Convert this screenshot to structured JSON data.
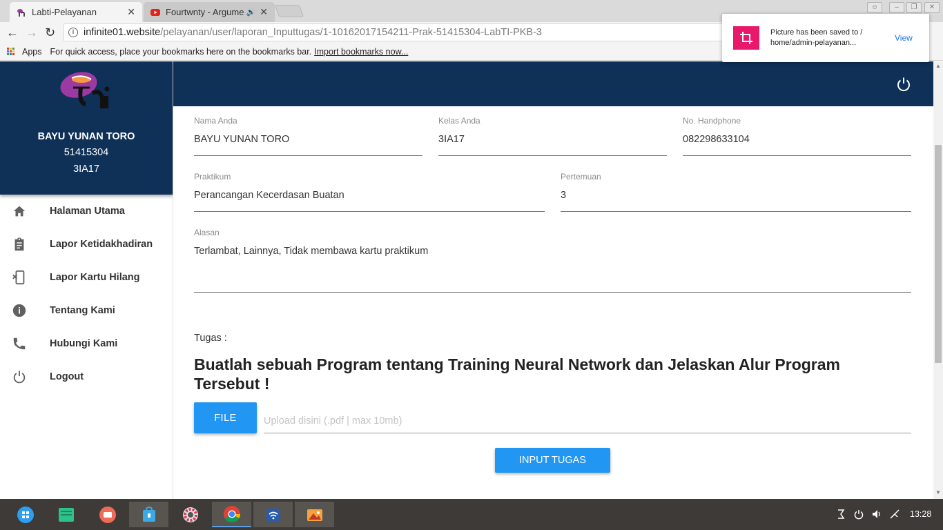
{
  "browser": {
    "tabs": [
      {
        "title": "Labti-Pelayanan",
        "active": true
      },
      {
        "title": "Fourtwnty - Argumen",
        "active": false,
        "audio": true
      }
    ],
    "url_host": "infinite01.website",
    "url_path": "/pelayanan/user/laporan_Inputtugas/1-10162017154211-Prak-51415304-LabTI-PKB-3",
    "bookmarks": {
      "apps_label": "Apps",
      "hint": "For quick access, place your bookmarks here on the bookmarks bar.",
      "import_link": "Import bookmarks now..."
    },
    "notification": {
      "line1": "Picture has been saved to /",
      "line2": "home/admin-pelayanan...",
      "action": "View"
    }
  },
  "profile": {
    "name": "BAYU YUNAN TORO",
    "npm": "51415304",
    "class": "3IA17"
  },
  "menu": [
    {
      "label": "Halaman Utama",
      "icon": "home-icon"
    },
    {
      "label": "Lapor Ketidakhadiran",
      "icon": "clipboard-icon"
    },
    {
      "label": "Lapor Kartu Hilang",
      "icon": "card-off-icon"
    },
    {
      "label": "Tentang Kami",
      "icon": "info-icon"
    },
    {
      "label": "Hubungi Kami",
      "icon": "phone-icon"
    },
    {
      "label": "Logout",
      "icon": "power-icon"
    }
  ],
  "form": {
    "nama": {
      "label": "Nama Anda",
      "value": "BAYU YUNAN TORO"
    },
    "kelas": {
      "label": "Kelas Anda",
      "value": "3IA17"
    },
    "hp": {
      "label": "No. Handphone",
      "value": "082298633104"
    },
    "praktikum": {
      "label": "Praktikum",
      "value": "Perancangan Kecerdasan Buatan"
    },
    "pertemuan": {
      "label": "Pertemuan",
      "value": "3"
    },
    "alasan": {
      "label": "Alasan",
      "value": "Terlambat, Lainnya, Tidak membawa kartu praktikum"
    },
    "tugas_label": "Tugas :",
    "tugas_text": "Buatlah sebuah Program tentang Training Neural Network dan Jelaskan Alur Program Tersebut !",
    "file_button": "FILE",
    "upload_placeholder": "Upload disini (.pdf | max 10mb)",
    "submit_button": "INPUT TUGAS"
  },
  "taskbar": {
    "clock": "13:28"
  },
  "colors": {
    "header": "#0f3057",
    "primary_button": "#2196f3",
    "taskbar": "#3d3a37"
  }
}
